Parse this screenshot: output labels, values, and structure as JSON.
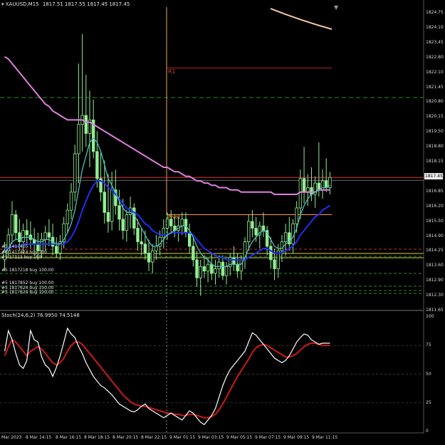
{
  "window": {
    "title": "XAUUSD,M15",
    "ohlc": "1817.51 1817.55 1817.45 1817.45"
  },
  "colors": {
    "background": "#000000",
    "bull": "#90ee90",
    "bear": "#90ee90",
    "ma_fast": "#4fbfbf",
    "ma_mid": "#1f2ff0",
    "ma_slow": "#e07ee0",
    "ma_long": "#f5c9a0",
    "pivot": "#ff9c3a",
    "r1": "#b01e1e",
    "stoch_main": "#ffffff",
    "stoch_signal": "#cc1a1a",
    "grid": "#6b6b6b",
    "bid_line": "#c0c0c0",
    "current_price_label_bg": "#f0f0f0"
  },
  "price_axis": {
    "ticks": [
      "1824.75",
      "1824.10",
      "1823.45",
      "1822.80",
      "1822.10",
      "1821.45",
      "1820.80",
      "1820.15",
      "1819.50",
      "1818.80",
      "1818.15",
      "1817.50",
      "1816.85",
      "1816.20",
      "1815.50",
      "1814.90",
      "1814.25",
      "1813.60",
      "1812.90",
      "1812.30",
      "1811.65"
    ],
    "current_price": "1817.45"
  },
  "time_axis": {
    "labels": [
      "Mar 2023",
      "8 Mar 14:15",
      "8 Mar 16:15",
      "8 Mar 18:15",
      "8 Mar 20:15",
      "8 Mar 22:15",
      "9 Mar 01:15",
      "9 Mar 03:15",
      "9 Mar 05:15",
      "9 Mar 07:15",
      "9 Mar 09:15",
      "9 Mar 11:15"
    ]
  },
  "pivots": {
    "r1_label": "R1",
    "pivot_label": "Pivot"
  },
  "orders": [
    {
      "text": "#5 1417405"
    },
    {
      "text": "#5 1411424 buy 100"
    },
    {
      "text": "#5 17111 buy 100"
    },
    {
      "text": "#5 1817218 buy 100.00"
    },
    {
      "text": "#5 1817852 buy 100.00"
    },
    {
      "text": "#5 1817624 buy 100.00"
    },
    {
      "text": "#5 1817624 buy 100.00"
    }
  ],
  "stochastic": {
    "title": "Stoch(24,6,2) 76.9950 74.5148",
    "axis": [
      "100",
      "75",
      "50",
      "25",
      "0"
    ]
  },
  "chart_data": {
    "type": "candlestick",
    "symbol": "XAUUSD",
    "timeframe": "M15",
    "ylim": [
      1811.65,
      1825.0
    ],
    "candles": [
      {
        "o": 1813.8,
        "h": 1814.6,
        "l": 1813.3,
        "c": 1814.2
      },
      {
        "o": 1814.2,
        "h": 1815.2,
        "l": 1813.9,
        "c": 1814.9
      },
      {
        "o": 1814.9,
        "h": 1816.4,
        "l": 1814.5,
        "c": 1815.8
      },
      {
        "o": 1815.8,
        "h": 1816.0,
        "l": 1814.7,
        "c": 1815.0
      },
      {
        "o": 1815.0,
        "h": 1815.6,
        "l": 1814.2,
        "c": 1814.6
      },
      {
        "o": 1814.6,
        "h": 1815.4,
        "l": 1814.1,
        "c": 1815.1
      },
      {
        "o": 1815.1,
        "h": 1815.6,
        "l": 1814.5,
        "c": 1814.9
      },
      {
        "o": 1814.9,
        "h": 1815.5,
        "l": 1814.3,
        "c": 1814.7
      },
      {
        "o": 1814.7,
        "h": 1815.2,
        "l": 1814.0,
        "c": 1814.5
      },
      {
        "o": 1814.5,
        "h": 1815.0,
        "l": 1813.8,
        "c": 1814.2
      },
      {
        "o": 1814.2,
        "h": 1815.0,
        "l": 1813.9,
        "c": 1814.7
      },
      {
        "o": 1814.7,
        "h": 1815.3,
        "l": 1814.2,
        "c": 1815.0
      },
      {
        "o": 1815.0,
        "h": 1815.6,
        "l": 1814.4,
        "c": 1814.8
      },
      {
        "o": 1814.8,
        "h": 1815.4,
        "l": 1814.0,
        "c": 1814.4
      },
      {
        "o": 1814.4,
        "h": 1814.8,
        "l": 1813.9,
        "c": 1814.1
      },
      {
        "o": 1814.1,
        "h": 1814.9,
        "l": 1813.8,
        "c": 1814.6
      },
      {
        "o": 1814.6,
        "h": 1815.7,
        "l": 1814.3,
        "c": 1815.4
      },
      {
        "o": 1815.4,
        "h": 1816.3,
        "l": 1815.0,
        "c": 1816.0
      },
      {
        "o": 1816.0,
        "h": 1817.2,
        "l": 1815.6,
        "c": 1816.8
      },
      {
        "o": 1816.8,
        "h": 1818.9,
        "l": 1816.4,
        "c": 1818.5
      },
      {
        "o": 1818.5,
        "h": 1822.5,
        "l": 1817.2,
        "c": 1819.8
      },
      {
        "o": 1819.8,
        "h": 1823.8,
        "l": 1818.6,
        "c": 1820.2
      },
      {
        "o": 1820.2,
        "h": 1822.0,
        "l": 1818.8,
        "c": 1819.4
      },
      {
        "o": 1819.4,
        "h": 1821.3,
        "l": 1817.9,
        "c": 1820.0
      },
      {
        "o": 1820.0,
        "h": 1820.9,
        "l": 1818.3,
        "c": 1818.6
      },
      {
        "o": 1818.6,
        "h": 1819.5,
        "l": 1817.0,
        "c": 1817.4
      },
      {
        "o": 1817.4,
        "h": 1818.6,
        "l": 1816.4,
        "c": 1816.8
      },
      {
        "o": 1816.8,
        "h": 1818.2,
        "l": 1815.4,
        "c": 1815.9
      },
      {
        "o": 1815.9,
        "h": 1817.6,
        "l": 1815.0,
        "c": 1815.5
      },
      {
        "o": 1815.5,
        "h": 1817.7,
        "l": 1815.1,
        "c": 1816.9
      },
      {
        "o": 1816.9,
        "h": 1817.8,
        "l": 1815.8,
        "c": 1816.2
      },
      {
        "o": 1816.2,
        "h": 1816.9,
        "l": 1815.1,
        "c": 1815.6
      },
      {
        "o": 1815.6,
        "h": 1816.5,
        "l": 1814.7,
        "c": 1815.1
      },
      {
        "o": 1815.1,
        "h": 1816.0,
        "l": 1814.6,
        "c": 1815.8
      },
      {
        "o": 1815.8,
        "h": 1816.6,
        "l": 1815.2,
        "c": 1816.1
      },
      {
        "o": 1816.1,
        "h": 1816.3,
        "l": 1814.9,
        "c": 1815.2
      },
      {
        "o": 1815.2,
        "h": 1815.6,
        "l": 1814.2,
        "c": 1814.6
      },
      {
        "o": 1814.6,
        "h": 1815.2,
        "l": 1814.0,
        "c": 1814.5
      },
      {
        "o": 1814.5,
        "h": 1815.1,
        "l": 1813.8,
        "c": 1814.1
      },
      {
        "o": 1814.1,
        "h": 1814.7,
        "l": 1813.3,
        "c": 1813.7
      },
      {
        "o": 1813.7,
        "h": 1814.5,
        "l": 1813.2,
        "c": 1814.2
      },
      {
        "o": 1814.2,
        "h": 1814.9,
        "l": 1813.8,
        "c": 1814.4
      },
      {
        "o": 1814.4,
        "h": 1815.1,
        "l": 1814.0,
        "c": 1814.8
      },
      {
        "o": 1814.8,
        "h": 1815.6,
        "l": 1814.3,
        "c": 1815.2
      },
      {
        "o": 1815.2,
        "h": 1815.9,
        "l": 1814.7,
        "c": 1815.6
      },
      {
        "o": 1815.6,
        "h": 1816.0,
        "l": 1815.0,
        "c": 1815.3
      },
      {
        "o": 1815.3,
        "h": 1815.8,
        "l": 1814.8,
        "c": 1815.1
      },
      {
        "o": 1815.1,
        "h": 1815.7,
        "l": 1814.6,
        "c": 1815.3
      },
      {
        "o": 1815.3,
        "h": 1815.9,
        "l": 1814.9,
        "c": 1815.6
      },
      {
        "o": 1815.6,
        "h": 1815.9,
        "l": 1814.8,
        "c": 1815.0
      },
      {
        "o": 1815.0,
        "h": 1815.4,
        "l": 1814.1,
        "c": 1814.4
      },
      {
        "o": 1814.4,
        "h": 1814.8,
        "l": 1813.5,
        "c": 1813.8
      },
      {
        "o": 1813.8,
        "h": 1814.2,
        "l": 1812.6,
        "c": 1813.0
      },
      {
        "o": 1813.0,
        "h": 1813.8,
        "l": 1812.2,
        "c": 1813.5
      },
      {
        "o": 1813.5,
        "h": 1814.0,
        "l": 1813.0,
        "c": 1813.3
      },
      {
        "o": 1813.3,
        "h": 1813.9,
        "l": 1812.8,
        "c": 1813.6
      },
      {
        "o": 1813.6,
        "h": 1814.1,
        "l": 1812.9,
        "c": 1813.2
      },
      {
        "o": 1813.2,
        "h": 1813.8,
        "l": 1812.7,
        "c": 1813.4
      },
      {
        "o": 1813.4,
        "h": 1814.0,
        "l": 1813.0,
        "c": 1813.7
      },
      {
        "o": 1813.7,
        "h": 1814.0,
        "l": 1812.9,
        "c": 1813.1
      },
      {
        "o": 1813.1,
        "h": 1813.7,
        "l": 1812.7,
        "c": 1813.5
      },
      {
        "o": 1813.5,
        "h": 1814.1,
        "l": 1813.1,
        "c": 1813.9
      },
      {
        "o": 1813.9,
        "h": 1814.4,
        "l": 1813.3,
        "c": 1813.6
      },
      {
        "o": 1813.6,
        "h": 1814.1,
        "l": 1813.0,
        "c": 1813.3
      },
      {
        "o": 1813.3,
        "h": 1814.0,
        "l": 1812.9,
        "c": 1813.8
      },
      {
        "o": 1813.8,
        "h": 1814.8,
        "l": 1813.4,
        "c": 1814.6
      },
      {
        "o": 1814.6,
        "h": 1815.8,
        "l": 1814.2,
        "c": 1815.5
      },
      {
        "o": 1815.5,
        "h": 1816.0,
        "l": 1814.8,
        "c": 1815.2
      },
      {
        "o": 1815.2,
        "h": 1815.7,
        "l": 1814.6,
        "c": 1814.9
      },
      {
        "o": 1814.9,
        "h": 1815.5,
        "l": 1814.3,
        "c": 1815.3
      },
      {
        "o": 1815.3,
        "h": 1815.9,
        "l": 1814.8,
        "c": 1815.1
      },
      {
        "o": 1815.1,
        "h": 1815.3,
        "l": 1814.0,
        "c": 1814.4
      },
      {
        "o": 1814.4,
        "h": 1814.8,
        "l": 1813.4,
        "c": 1813.8
      },
      {
        "o": 1813.8,
        "h": 1814.3,
        "l": 1812.9,
        "c": 1813.4
      },
      {
        "o": 1813.4,
        "h": 1814.5,
        "l": 1813.0,
        "c": 1814.2
      },
      {
        "o": 1814.2,
        "h": 1814.9,
        "l": 1813.7,
        "c": 1814.6
      },
      {
        "o": 1814.6,
        "h": 1815.4,
        "l": 1814.0,
        "c": 1815.0
      },
      {
        "o": 1815.0,
        "h": 1815.7,
        "l": 1814.2,
        "c": 1814.5
      },
      {
        "o": 1814.5,
        "h": 1815.6,
        "l": 1814.1,
        "c": 1815.4
      },
      {
        "o": 1815.4,
        "h": 1816.4,
        "l": 1815.0,
        "c": 1816.1
      },
      {
        "o": 1816.1,
        "h": 1817.8,
        "l": 1815.6,
        "c": 1817.4
      },
      {
        "o": 1817.4,
        "h": 1818.8,
        "l": 1816.3,
        "c": 1816.8
      },
      {
        "o": 1816.8,
        "h": 1817.6,
        "l": 1816.2,
        "c": 1817.0
      },
      {
        "o": 1817.0,
        "h": 1817.9,
        "l": 1816.4,
        "c": 1816.7
      },
      {
        "o": 1816.7,
        "h": 1817.5,
        "l": 1816.1,
        "c": 1817.2
      },
      {
        "o": 1817.2,
        "h": 1819.0,
        "l": 1816.6,
        "c": 1816.9
      },
      {
        "o": 1816.9,
        "h": 1817.8,
        "l": 1816.5,
        "c": 1817.3
      },
      {
        "o": 1817.3,
        "h": 1818.3,
        "l": 1816.8,
        "c": 1817.0
      },
      {
        "o": 1817.0,
        "h": 1817.7,
        "l": 1816.7,
        "c": 1817.45
      }
    ],
    "ma_fast": [
      1814.1,
      1814.3,
      1814.6,
      1814.7,
      1814.7,
      1814.8,
      1814.8,
      1814.8,
      1814.7,
      1814.6,
      1814.6,
      1814.7,
      1814.7,
      1814.6,
      1814.5,
      1814.5,
      1814.7,
      1815.0,
      1815.4,
      1816.0,
      1816.9,
      1817.8,
      1818.4,
      1819.0,
      1819.2,
      1819.0,
      1818.6,
      1818.0,
      1817.4,
      1817.1,
      1816.8,
      1816.4,
      1816.1,
      1815.9,
      1815.9,
      1815.8,
      1815.5,
      1815.2,
      1814.9,
      1814.6,
      1814.4,
      1814.4,
      1814.5,
      1814.7,
      1814.9,
      1815.0,
      1815.1,
      1815.2,
      1815.3,
      1815.3,
      1815.1,
      1814.8,
      1814.4,
      1814.1,
      1813.9,
      1813.8,
      1813.6,
      1813.5,
      1813.5,
      1813.5,
      1813.5,
      1813.6,
      1813.6,
      1813.6,
      1813.6,
      1813.9,
      1814.3,
      1814.6,
      1814.8,
      1815.0,
      1815.1,
      1815.0,
      1814.7,
      1814.4,
      1814.3,
      1814.3,
      1814.5,
      1814.6,
      1814.8,
      1815.2,
      1815.8,
      1816.2,
      1816.5,
      1816.7,
      1816.8,
      1816.9,
      1817.0,
      1817.0,
      1817.1
    ],
    "ma_mid": [
      1814.3,
      1814.3,
      1814.4,
      1814.4,
      1814.4,
      1814.5,
      1814.5,
      1814.5,
      1814.5,
      1814.5,
      1814.5,
      1814.5,
      1814.5,
      1814.5,
      1814.5,
      1814.5,
      1814.5,
      1814.6,
      1814.8,
      1815.1,
      1815.5,
      1816.0,
      1816.4,
      1816.8,
      1817.1,
      1817.3,
      1817.3,
      1817.2,
      1817.0,
      1816.9,
      1816.7,
      1816.5,
      1816.3,
      1816.1,
      1816.0,
      1815.9,
      1815.8,
      1815.6,
      1815.4,
      1815.3,
      1815.1,
      1815.0,
      1814.9,
      1814.9,
      1814.9,
      1815.0,
      1815.0,
      1815.0,
      1815.0,
      1815.0,
      1815.0,
      1814.9,
      1814.7,
      1814.5,
      1814.3,
      1814.2,
      1814.1,
      1814.0,
      1813.9,
      1813.9,
      1813.8,
      1813.8,
      1813.8,
      1813.8,
      1813.8,
      1813.8,
      1813.9,
      1814.0,
      1814.1,
      1814.2,
      1814.3,
      1814.3,
      1814.2,
      1814.1,
      1814.1,
      1814.1,
      1814.2,
      1814.3,
      1814.4,
      1814.6,
      1814.9,
      1815.1,
      1815.3,
      1815.5,
      1815.7,
      1815.8,
      1816.0,
      1816.1,
      1816.2
    ],
    "ma_slow": [
      1822.8,
      1822.7,
      1822.5,
      1822.3,
      1822.1,
      1821.9,
      1821.7,
      1821.5,
      1821.3,
      1821.1,
      1820.9,
      1820.7,
      1820.6,
      1820.4,
      1820.3,
      1820.2,
      1820.1,
      1820.0,
      1820.0,
      1820.0,
      1820.0,
      1820.0,
      1819.9,
      1819.9,
      1819.8,
      1819.7,
      1819.6,
      1819.5,
      1819.4,
      1819.3,
      1819.2,
      1819.1,
      1819.0,
      1818.9,
      1818.8,
      1818.7,
      1818.6,
      1818.5,
      1818.4,
      1818.3,
      1818.2,
      1818.1,
      1818.0,
      1817.9,
      1817.9,
      1817.8,
      1817.7,
      1817.7,
      1817.6,
      1817.5,
      1817.5,
      1817.4,
      1817.3,
      1817.3,
      1817.2,
      1817.2,
      1817.1,
      1817.1,
      1817.0,
      1817.0,
      1817.0,
      1816.9,
      1816.9,
      1816.9,
      1816.8,
      1816.8,
      1816.8,
      1816.8,
      1816.8,
      1816.8,
      1816.8,
      1816.8,
      1816.8,
      1816.7,
      1816.7,
      1816.7,
      1816.7,
      1816.7,
      1816.7,
      1816.7,
      1816.8,
      1816.8,
      1816.8,
      1816.8,
      1816.8,
      1816.9,
      1816.9,
      1816.9,
      1816.9
    ],
    "r1": 1822.3,
    "pivot": 1815.8,
    "bid": 1817.45,
    "stoch_main": [
      70,
      88,
      80,
      68,
      58,
      55,
      62,
      88,
      80,
      78,
      65,
      58,
      55,
      48,
      56,
      66,
      78,
      90,
      85,
      82,
      74,
      68,
      60,
      54,
      48,
      44,
      40,
      38,
      35,
      32,
      28,
      24,
      22,
      20,
      18,
      17,
      19,
      22,
      24,
      20,
      18,
      16,
      14,
      12,
      14,
      16,
      14,
      12,
      10,
      14,
      18,
      16,
      12,
      8,
      6,
      10,
      14,
      20,
      30,
      40,
      48,
      54,
      58,
      62,
      66,
      70,
      78,
      86,
      84,
      80,
      76,
      72,
      68,
      64,
      62,
      60,
      62,
      66,
      72,
      78,
      82,
      85,
      84,
      80,
      78,
      76,
      77,
      77,
      77
    ],
    "stoch_signal": [
      66,
      74,
      80,
      78,
      74,
      70,
      66,
      70,
      72,
      74,
      72,
      68,
      64,
      60,
      58,
      60,
      64,
      70,
      75,
      78,
      78,
      76,
      72,
      68,
      64,
      60,
      56,
      52,
      48,
      44,
      40,
      36,
      32,
      29,
      26,
      24,
      23,
      22,
      22,
      21,
      20,
      19,
      18,
      17,
      16,
      16,
      15,
      15,
      14,
      14,
      15,
      15,
      14,
      13,
      12,
      12,
      13,
      15,
      19,
      24,
      30,
      36,
      42,
      48,
      53,
      58,
      63,
      69,
      73,
      75,
      76,
      75,
      73,
      71,
      69,
      67,
      65,
      65,
      66,
      68,
      71,
      74,
      76,
      77,
      77,
      76,
      75,
      75,
      75
    ]
  }
}
